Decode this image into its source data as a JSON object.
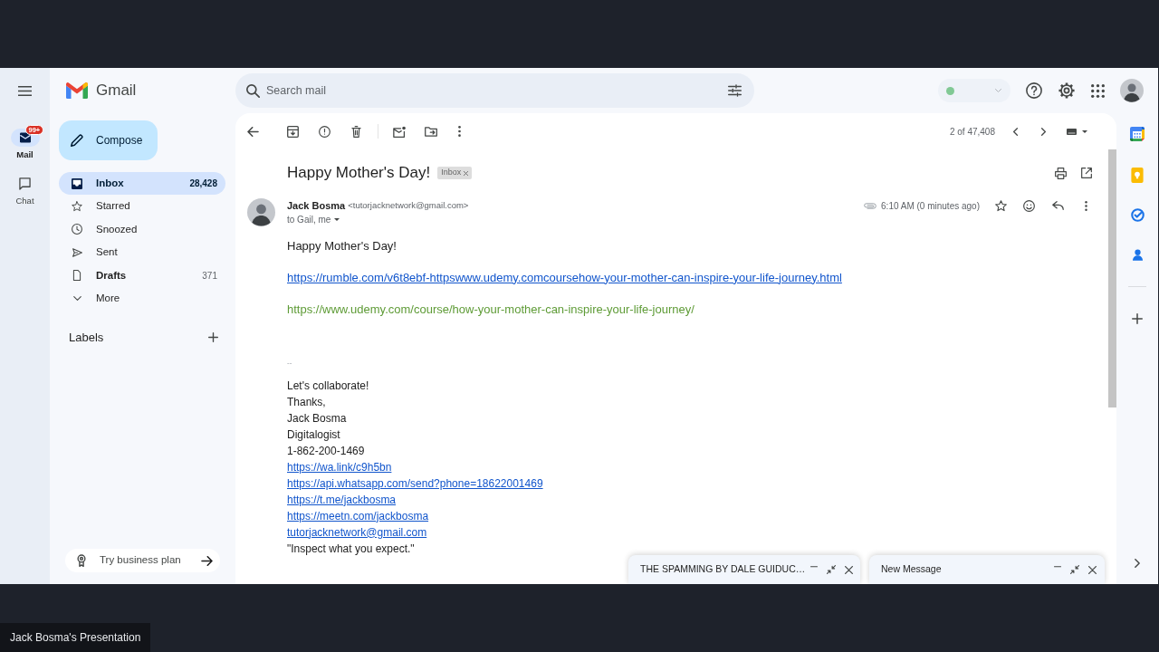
{
  "rail": [
    {
      "label": "Mail",
      "badge": "99+",
      "selected": true
    },
    {
      "label": "Chat",
      "selected": false
    }
  ],
  "brand": "Gmail",
  "compose_button": "Compose",
  "folders": [
    {
      "label": "Inbox",
      "count": "28,428",
      "selected": true,
      "unread": true
    },
    {
      "label": "Starred",
      "selected": false,
      "unread": false
    },
    {
      "label": "Snoozed",
      "selected": false,
      "unread": false
    },
    {
      "label": "Sent",
      "selected": false,
      "unread": false
    },
    {
      "label": "Drafts",
      "count": "371",
      "selected": false,
      "unread": true
    },
    {
      "label": "More",
      "selected": false,
      "unread": false
    }
  ],
  "labels_heading": "Labels",
  "upgrade_button": "Try business plan",
  "search": {
    "placeholder": "Search mail"
  },
  "status_indicator": {
    "on": true
  },
  "pager": "2 of 47,408",
  "message": {
    "subject": "Happy Mother's Day!",
    "label_chip": "Inbox",
    "sender_name": "Jack Bosma",
    "sender_email": "<tutorjacknetwork@gmail.com>",
    "recipients": "to Gail, me",
    "time": "6:10 AM (0 minutes ago)",
    "body": [
      {
        "kind": "text",
        "text": "Happy Mother's Day!"
      },
      {
        "kind": "link",
        "text": "https://rumble.com/v6t8ebf-httpswww.udemy.comcoursehow-your-mother-can-inspire-your-life-journey.html"
      },
      {
        "kind": "greenlink",
        "text": "https://www.udemy.com/course/how-your-mother-can-inspire-your-life-journey/"
      }
    ],
    "signature_separator": "--",
    "signature": [
      {
        "kind": "text",
        "text": "Let's collaborate!"
      },
      {
        "kind": "text",
        "text": "Thanks,"
      },
      {
        "kind": "text",
        "text": "Jack Bosma"
      },
      {
        "kind": "text",
        "text": "Digitalogist"
      },
      {
        "kind": "text",
        "text": "1-862-200-1469"
      },
      {
        "kind": "link",
        "text": "https://wa.link/c9h5bn"
      },
      {
        "kind": "link",
        "text": "https://api.whatsapp.com/send?phone=18622001469"
      },
      {
        "kind": "link",
        "text": "https://t.me/jackbosma"
      },
      {
        "kind": "link",
        "text": "https://meetn.com/jackbosma"
      },
      {
        "kind": "link",
        "text": "tutorjacknetwork@gmail.com"
      },
      {
        "kind": "text",
        "text": "\"Inspect what you expect.\""
      }
    ]
  },
  "compose_windows": [
    {
      "title": "THE SPAMMING BY DALE GUIDUC…"
    },
    {
      "title": "New Message"
    }
  ],
  "presentation_label": "Jack Bosma's Presentation"
}
